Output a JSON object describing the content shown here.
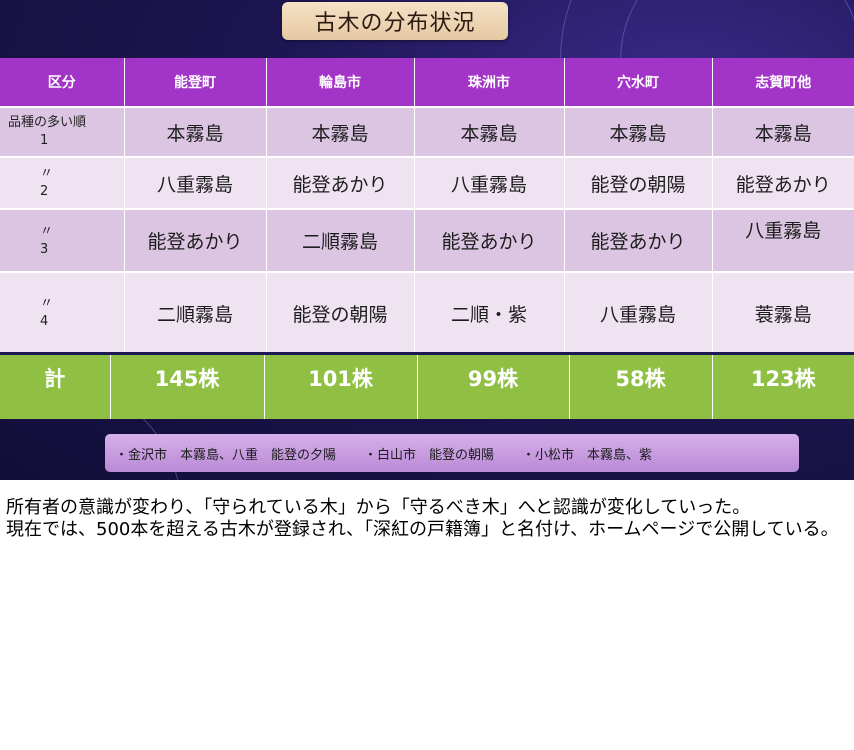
{
  "title": "古木の分布状況",
  "table": {
    "header": [
      "区分",
      "能登町",
      "輪島市",
      "珠洲市",
      "穴水町",
      "志賀町他"
    ],
    "rows": [
      {
        "label_top": "品種の多い順",
        "label_num": "1",
        "cells": [
          "本霧島",
          "本霧島",
          "本霧島",
          "本霧島",
          "本霧島"
        ]
      },
      {
        "label_top": "〃",
        "label_num": "2",
        "cells": [
          "八重霧島",
          "能登あかり",
          "八重霧島",
          "能登の朝陽",
          "能登あかり"
        ]
      },
      {
        "label_top": "〃",
        "label_num": "3",
        "cells": [
          "能登あかり",
          "二順霧島",
          "能登あかり",
          "能登あかり",
          "八重霧島"
        ]
      },
      {
        "label_top": "〃",
        "label_num": "4",
        "cells": [
          "二順霧島",
          "能登の朝陽",
          "二順・紫",
          "八重霧島",
          "蓑霧島"
        ]
      }
    ],
    "total": {
      "label": "計",
      "values": [
        "145株",
        "101株",
        "99株",
        "58株",
        "123株"
      ]
    }
  },
  "notes": [
    "・金沢市　本霧島、八重　能登の夕陽",
    "・白山市　能登の朝陽",
    "・小松市　本霧島、紫"
  ],
  "paragraphs": [
    "所有者の意識が変わり、「守られている木」から「守るべき木」へと認識が変化していった。",
    "現在では、500本を超える古木が登録され、「深紅の戸籍簿」と名付け、ホームページで公開している。"
  ],
  "colors": {
    "header": "#a334c8",
    "row_odd": "#dcc5e2",
    "row_even": "#efe3f1",
    "total": "#8fc043",
    "title_box": "#f0d9b9",
    "background": "#1c1550"
  }
}
